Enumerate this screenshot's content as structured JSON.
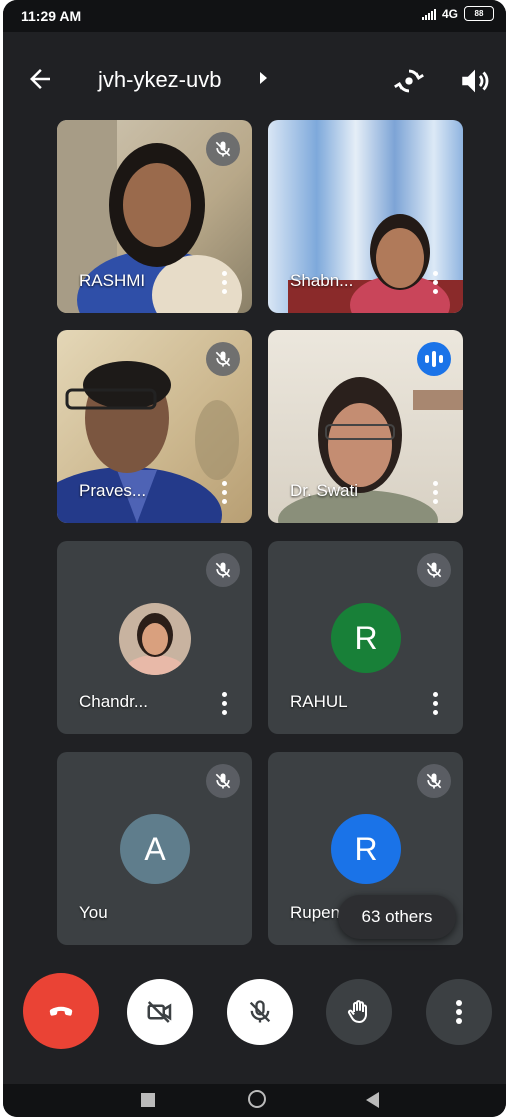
{
  "status_bar": {
    "time": "11:29 AM",
    "network": "4G",
    "battery": "88"
  },
  "meeting": {
    "code": "jvh-ykez-uvb"
  },
  "participants": [
    {
      "name": "RASHMI",
      "state": "muted"
    },
    {
      "name": "Shabn...",
      "state": "none"
    },
    {
      "name": "Praves...",
      "state": "muted"
    },
    {
      "name": "Dr. Swati",
      "state": "speaking"
    },
    {
      "name": "Chandr...",
      "state": "muted"
    },
    {
      "name": "RAHUL",
      "state": "muted",
      "initial": "R",
      "color": "#188038"
    },
    {
      "name": "You",
      "state": "muted",
      "initial": "A",
      "color": "#5f7d8c"
    },
    {
      "name": "Rupen",
      "state": "muted",
      "initial": "R",
      "color": "#1a73e8"
    }
  ],
  "others_label": "63 others",
  "controls": {
    "end_call_color": "#ea4335",
    "camera_state": "off",
    "mic_state": "off"
  }
}
